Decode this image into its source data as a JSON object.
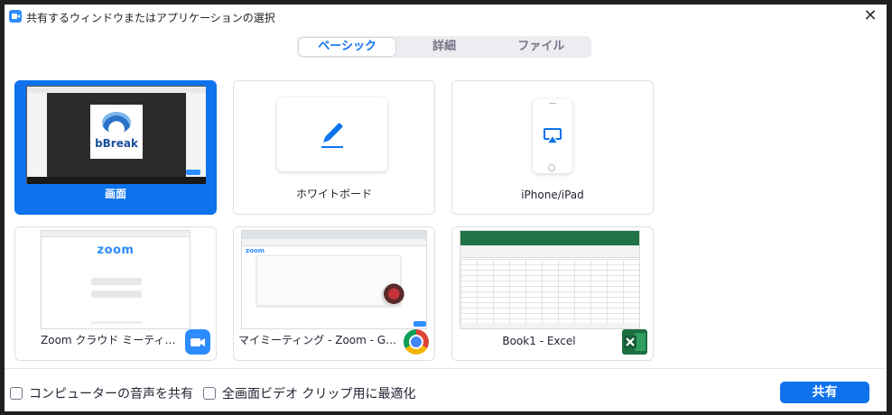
{
  "window": {
    "title": "共有するウィンドウまたはアプリケーションの選択",
    "close_glyph": "✕"
  },
  "tabs": [
    {
      "label": "ベーシック",
      "active": true
    },
    {
      "label": "詳細",
      "active": false
    },
    {
      "label": "ファイル",
      "active": false
    }
  ],
  "cards": {
    "screen": {
      "label": "画面",
      "thumb_text": "bBreak"
    },
    "whiteboard": {
      "label": "ホワイトボード"
    },
    "iphone": {
      "label": "iPhone/iPad"
    },
    "zoom_meeting": {
      "label": "Zoom クラウド ミーティング",
      "thumb_logo": "zoom"
    },
    "chrome": {
      "label": "マイミーティング - Zoom - Google ...",
      "thumb_logo": "zoom"
    },
    "excel": {
      "label": "Book1 - Excel"
    }
  },
  "footer": {
    "share_audio_label": "コンピューターの音声を共有",
    "optimize_video_label": "全画面ビデオ クリップ用に最適化",
    "share_button_label": "共有"
  },
  "colors": {
    "accent": "#0E72ED",
    "zoom_blue": "#2D8CFF",
    "excel_green": "#1D6F42"
  }
}
